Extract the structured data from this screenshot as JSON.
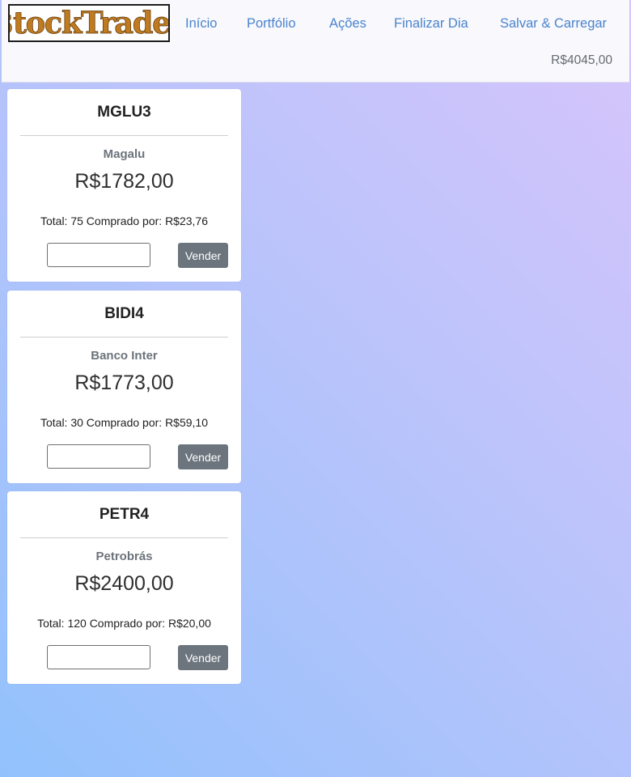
{
  "brand": {
    "logo_text": "$tockTrader"
  },
  "nav": {
    "links": [
      "Início",
      "Portfólio",
      "Ações",
      "Finalizar Dia",
      "Salvar & Carregar"
    ],
    "funds": "R$4045,00"
  },
  "portfolio": [
    {
      "symbol": "MGLU3",
      "company": "Magalu",
      "price": "R$1782,00",
      "total_text": "Total: 75 Comprado por: R$23,76",
      "quantity_value": "",
      "sell_label": "Vender"
    },
    {
      "symbol": "BIDI4",
      "company": "Banco Inter",
      "price": "R$1773,00",
      "total_text": "Total: 30 Comprado por: R$59,10",
      "quantity_value": "",
      "sell_label": "Vender"
    },
    {
      "symbol": "PETR4",
      "company": "Petrobrás",
      "price": "R$2400,00",
      "total_text": "Total: 120 Comprado por: R$20,00",
      "quantity_value": "",
      "sell_label": "Vender"
    }
  ],
  "colors": {
    "nav_link": "#4a84cc",
    "sell_button": "#6c757d",
    "logo_gold": "#c07a1f",
    "background_start": "#92c2fc",
    "background_end": "#d6c5fb"
  }
}
